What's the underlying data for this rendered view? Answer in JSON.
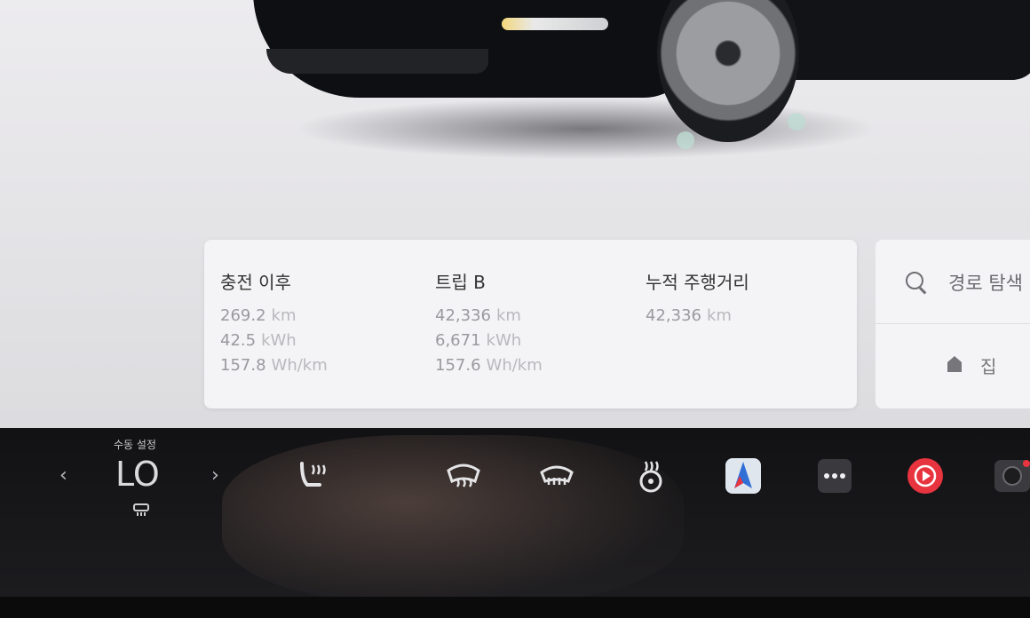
{
  "trip_panel": {
    "since_charge": {
      "title": "충전 이후",
      "rows": [
        {
          "value": "269.2",
          "unit": "km"
        },
        {
          "value": "42.5",
          "unit": "kWh"
        },
        {
          "value": "157.8",
          "unit": "Wh/km"
        }
      ]
    },
    "trip_b": {
      "title": "트립 B",
      "rows": [
        {
          "value": "42,336",
          "unit": "km"
        },
        {
          "value": "6,671",
          "unit": "kWh"
        },
        {
          "value": "157.6",
          "unit": "Wh/km"
        }
      ]
    },
    "odometer": {
      "title": "누적 주행거리",
      "rows": [
        {
          "value": "42,336",
          "unit": "km"
        }
      ]
    }
  },
  "navigation": {
    "search_label": "경로 탐색",
    "home_label": "집"
  },
  "climate": {
    "mode_caption": "수동 설정",
    "temperature": "LO",
    "prev_symbol": "‹",
    "next_symbol": "›"
  },
  "dock_icons": [
    "seat-heater-icon",
    "front-defrost-icon",
    "rear-defrost-icon",
    "steering-wheel-heater-icon",
    "maps-app-icon",
    "more-apps-icon",
    "music-app-icon",
    "camera-app-icon"
  ],
  "colors": {
    "music_red": "#e8343f",
    "maps_blue": "#2f6fd6"
  }
}
